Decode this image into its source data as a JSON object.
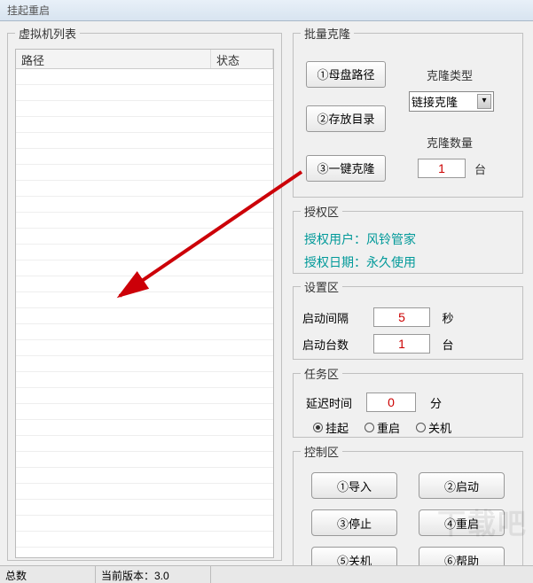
{
  "window": {
    "title": "挂起重启"
  },
  "list": {
    "legend": "虚拟机列表",
    "columns": {
      "path": "路径",
      "status": "状态"
    }
  },
  "clone": {
    "legend": "批量克隆",
    "btn_mother": "①母盘路径",
    "btn_savedir": "②存放目录",
    "btn_oneclone": "③一键克隆",
    "type_label": "克隆类型",
    "type_value": "链接克隆",
    "qty_label": "克隆数量",
    "qty_value": "1",
    "unit_tai": "台"
  },
  "auth": {
    "legend": "授权区",
    "user": "授权用户：风铃管家",
    "date": "授权日期：永久使用"
  },
  "settings": {
    "legend": "设置区",
    "interval_label": "启动间隔",
    "interval_value": "5",
    "interval_unit": "秒",
    "count_label": "启动台数",
    "count_value": "1",
    "count_unit": "台"
  },
  "task": {
    "legend": "任务区",
    "delay_label": "延迟时间",
    "delay_value": "0",
    "delay_unit": "分",
    "radios": {
      "suspend": "挂起",
      "restart": "重启",
      "shutdown": "关机"
    },
    "selected": "suspend"
  },
  "ctrl": {
    "legend": "控制区",
    "import": "①导入",
    "start": "②启动",
    "stop": "③停止",
    "restart": "④重启",
    "shutdown": "⑤关机",
    "help": "⑥帮助"
  },
  "statusbar": {
    "total": "总数",
    "version": "当前版本：3.0"
  },
  "watermark": "下载吧"
}
